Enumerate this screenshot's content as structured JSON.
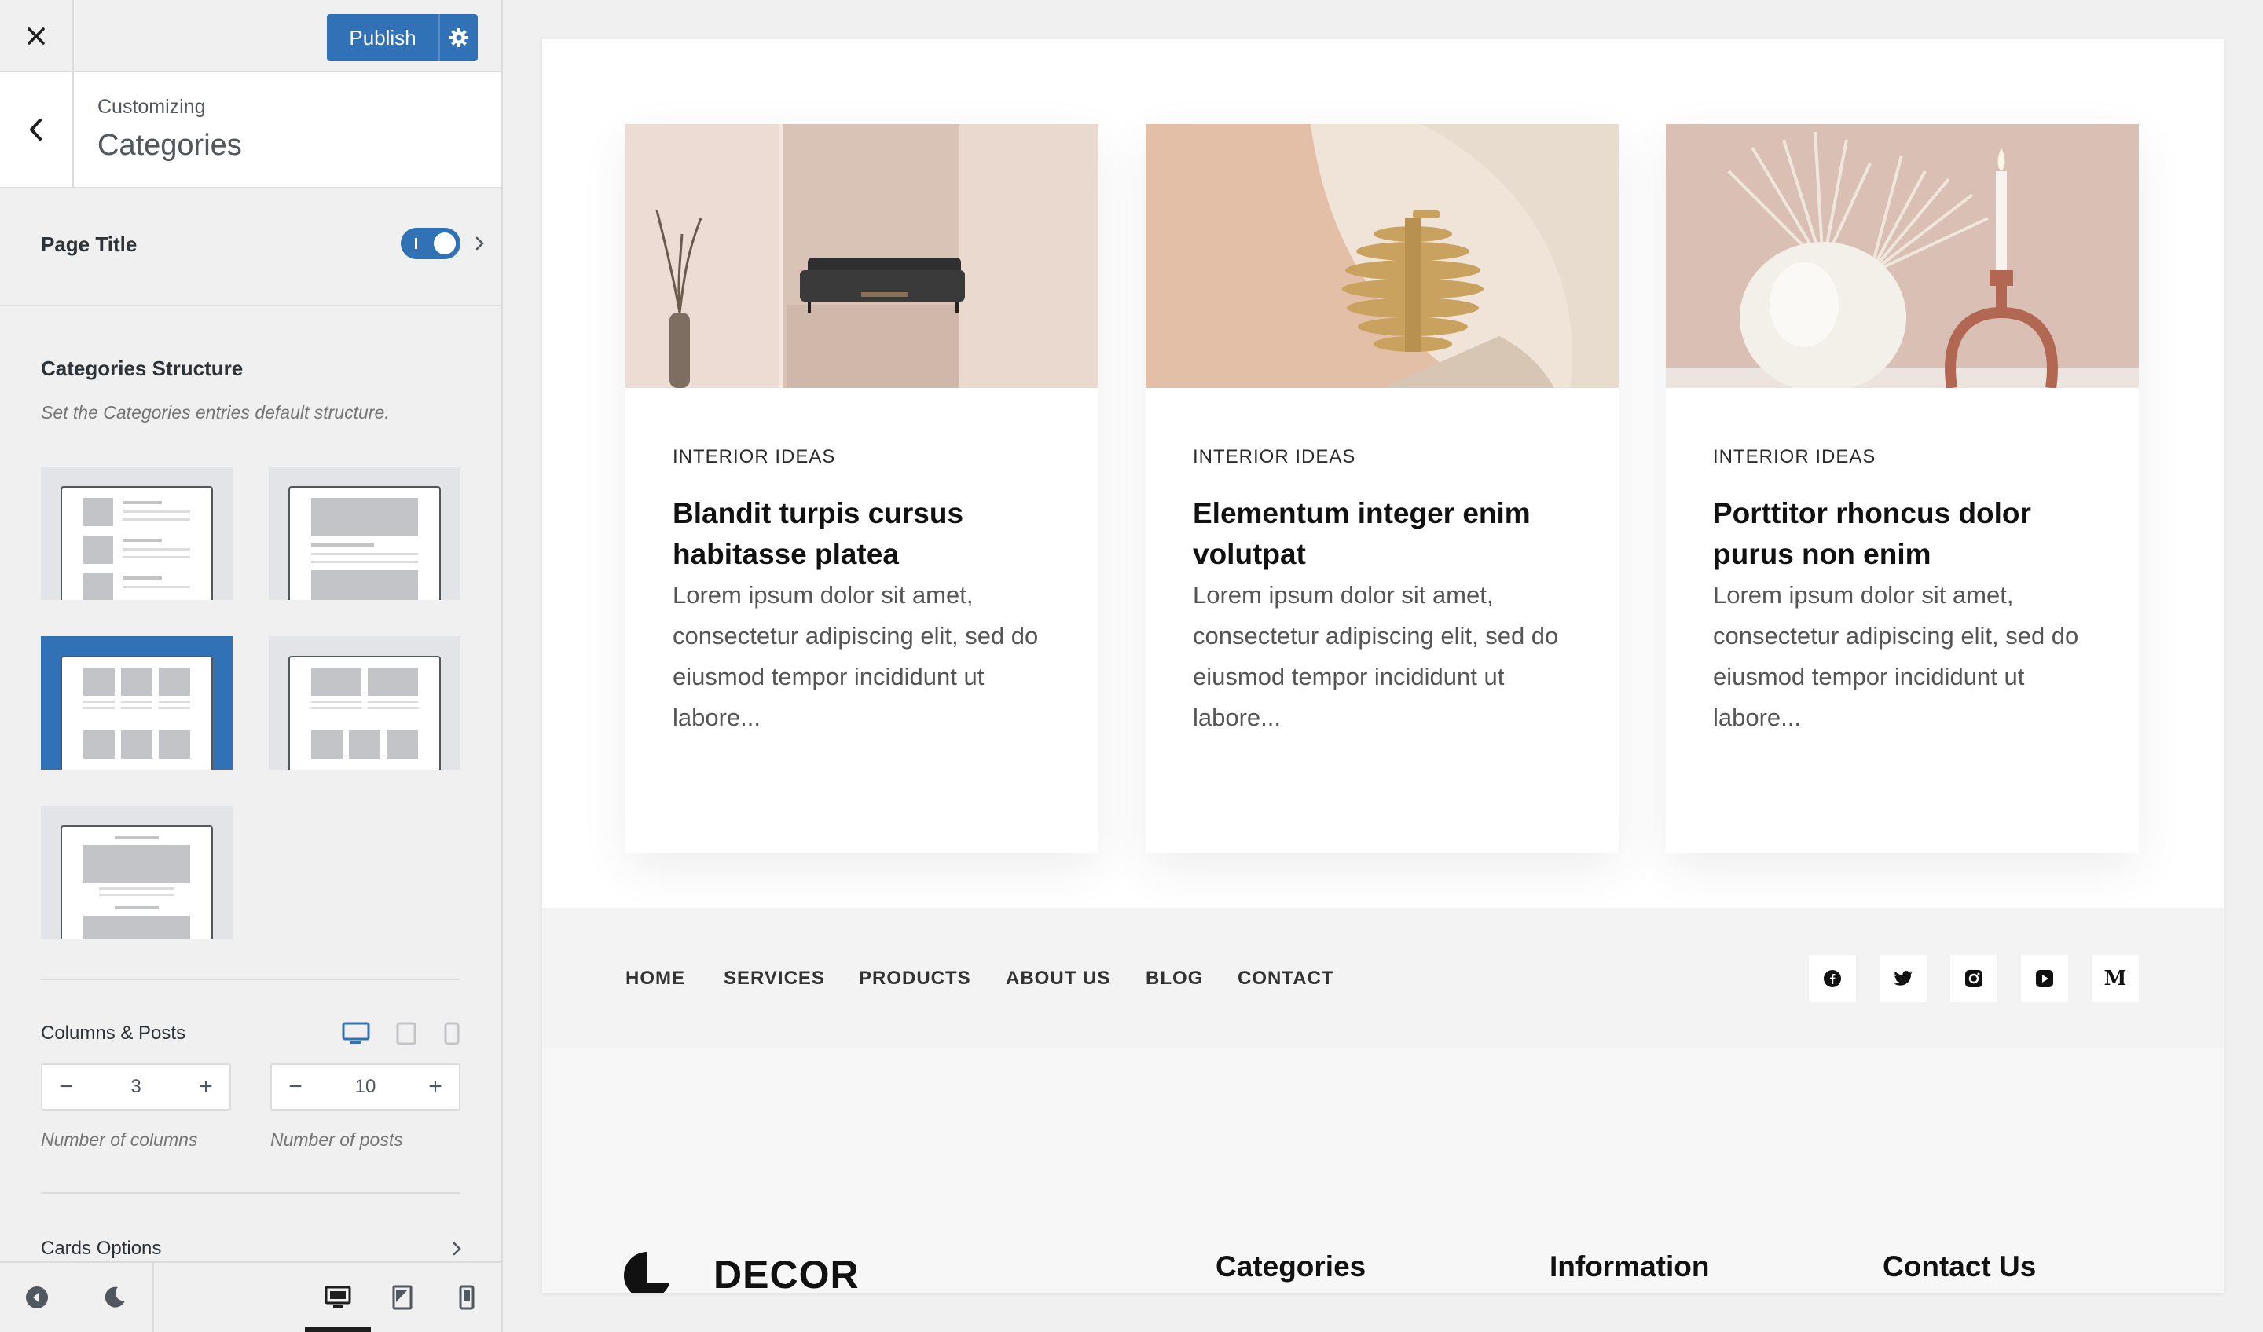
{
  "colors": {
    "accent": "#3171b5",
    "sidebar_bg": "#f0f0f1",
    "preview_bg": "#ffffff"
  },
  "topbar": {
    "close_icon": "close-icon",
    "publish_label": "Publish",
    "settings_icon": "gear-icon"
  },
  "section": {
    "customizing_label": "Customizing",
    "title": "Categories"
  },
  "page_title": {
    "label": "Page Title",
    "enabled": true
  },
  "structure": {
    "title": "Categories Structure",
    "description": "Set the Categories entries default structure.",
    "selected_option": 3
  },
  "columns_posts": {
    "label": "Columns & Posts",
    "columns_value": "3",
    "posts_value": "10",
    "columns_help": "Number of columns",
    "posts_help": "Number of posts",
    "minus": "−",
    "plus": "+"
  },
  "cards_options": {
    "label": "Cards Options"
  },
  "cards": [
    {
      "category": "INTERIOR IDEAS",
      "title": "Blandit turpis cursus habitasse platea",
      "excerpt": "Lorem ipsum dolor sit amet, consectetur adipiscing elit, sed do eiusmod tempor incididunt ut labore..."
    },
    {
      "category": "INTERIOR IDEAS",
      "title": "Elementum integer enim volutpat",
      "excerpt": "Lorem ipsum dolor sit amet, consectetur adipiscing elit, sed do eiusmod tempor incididunt ut labore..."
    },
    {
      "category": "INTERIOR IDEAS",
      "title": "Porttitor rhoncus dolor purus non enim",
      "excerpt": "Lorem ipsum dolor sit amet, consectetur adipiscing elit, sed do eiusmod tempor incididunt ut labore..."
    }
  ],
  "footer_nav": [
    "HOME",
    "SERVICES",
    "PRODUCTS",
    "ABOUT US",
    "BLOG",
    "CONTACT"
  ],
  "social": [
    "facebook-icon",
    "twitter-icon",
    "instagram-icon",
    "youtube-icon",
    "medium-icon"
  ],
  "social_medium_letter": "M",
  "footer": {
    "logo_text": "DECOR",
    "headings": [
      "Categories",
      "Information",
      "Contact Us"
    ]
  }
}
